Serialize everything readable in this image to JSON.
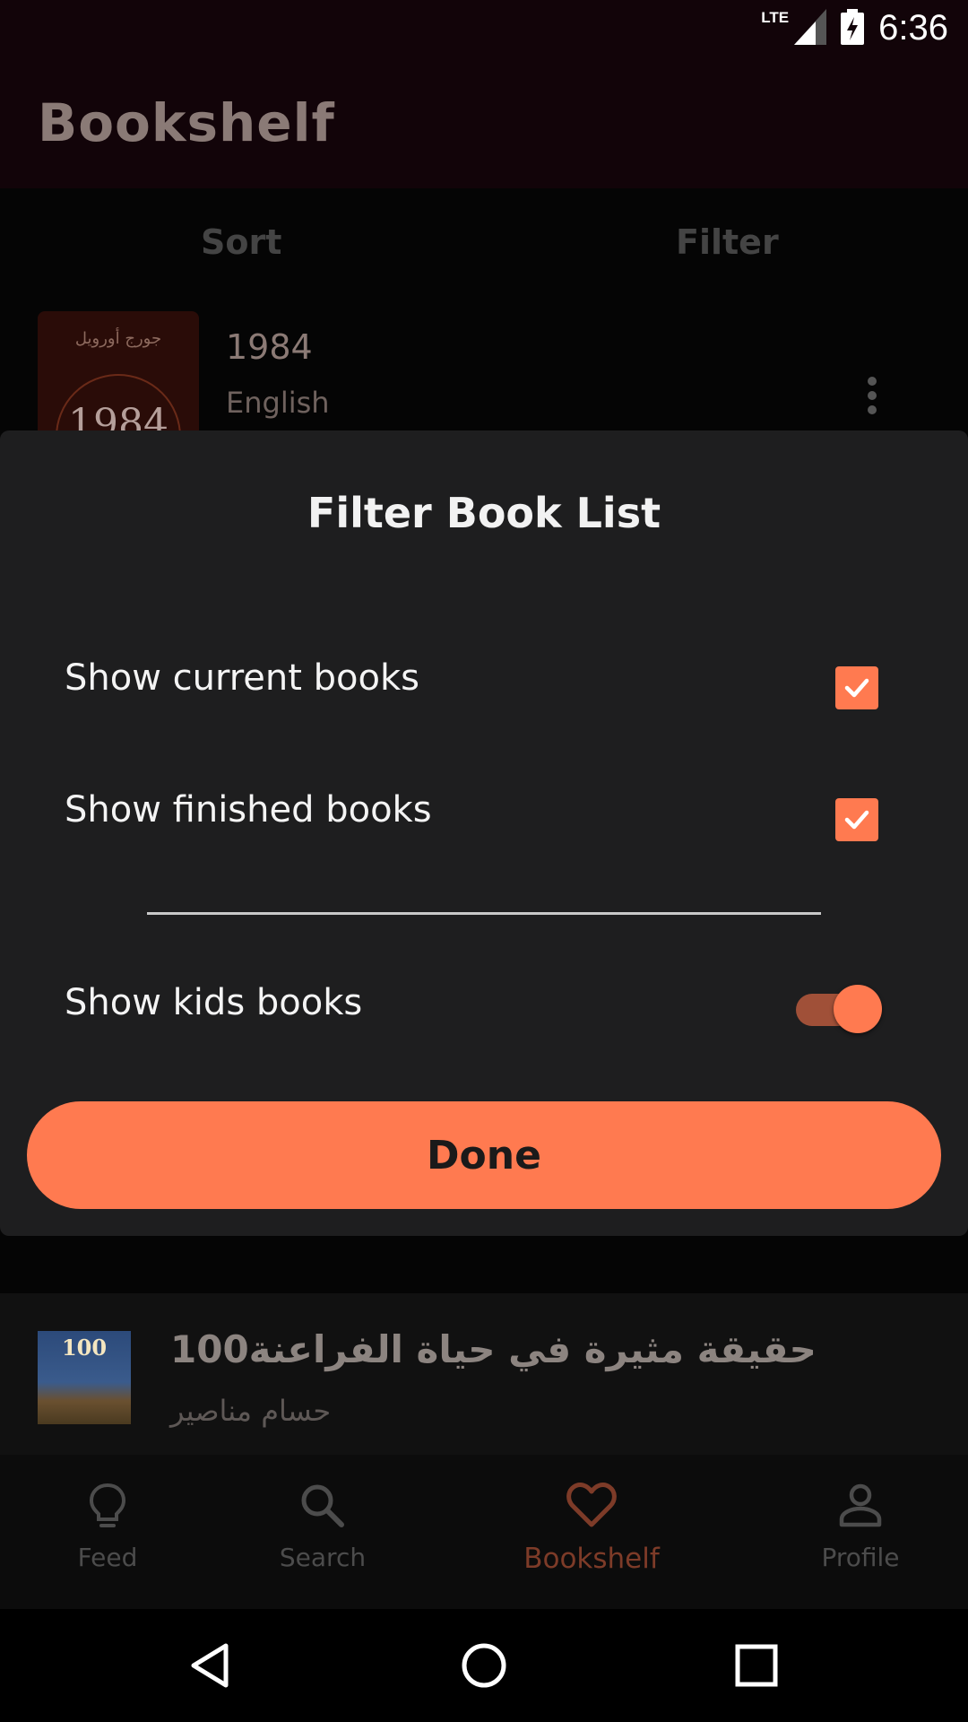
{
  "status_bar": {
    "network": "LTE",
    "time": "6:36"
  },
  "app_bar": {
    "title": "Bookshelf"
  },
  "sort_filter": {
    "sort_label": "Sort",
    "filter_label": "Filter"
  },
  "books": [
    {
      "cover_text_top": "جورج أورويل",
      "cover_text_main": "1984",
      "title": "1984",
      "subtitle": "English"
    },
    {
      "cover_text_main": "100",
      "title": "حقيقة مثيرة في حياة الفراعنة100",
      "subtitle": "حسام مناصير"
    }
  ],
  "dialog": {
    "title": "Filter Book List",
    "options": [
      {
        "label": "Show current books",
        "checked": true
      },
      {
        "label": "Show finished books",
        "checked": true
      }
    ],
    "kids_toggle": {
      "label": "Show kids books",
      "on": true
    },
    "done_label": "Done"
  },
  "bottom_nav": {
    "items": [
      {
        "label": "Feed",
        "icon": "lightbulb-icon",
        "active": false
      },
      {
        "label": "Search",
        "icon": "search-icon",
        "active": false
      },
      {
        "label": "Bookshelf",
        "icon": "heart-icon",
        "active": true
      },
      {
        "label": "Profile",
        "icon": "person-icon",
        "active": false
      }
    ]
  },
  "colors": {
    "accent": "#ff7a50",
    "dialog_bg": "#1e1e1f",
    "app_bar_bg": "#120409"
  }
}
